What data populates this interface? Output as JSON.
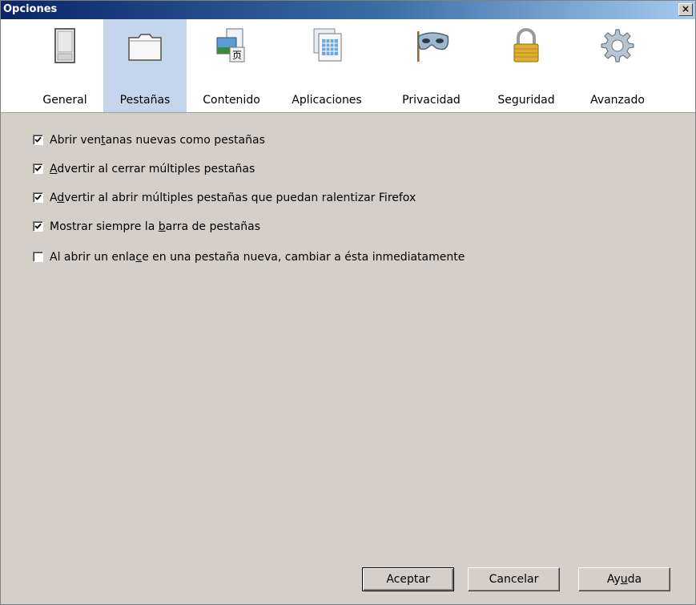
{
  "window": {
    "title": "Opciones",
    "close_label": "×"
  },
  "tabs": [
    {
      "label": "General",
      "icon": "general-icon"
    },
    {
      "label": "Pestañas",
      "icon": "tabs-icon",
      "selected": true
    },
    {
      "label": "Contenido",
      "icon": "content-icon"
    },
    {
      "label": "Aplicaciones",
      "icon": "applications-icon"
    },
    {
      "label": "Privacidad",
      "icon": "privacy-mask-icon"
    },
    {
      "label": "Seguridad",
      "icon": "padlock-icon"
    },
    {
      "label": "Avanzado",
      "icon": "gear-icon"
    }
  ],
  "options": [
    {
      "pre": "Abrir ven",
      "acc": "t",
      "post": "anas nuevas como pestañas",
      "checked": true
    },
    {
      "pre": "",
      "acc": "A",
      "post": "dvertir al cerrar múltiples pestañas",
      "checked": true
    },
    {
      "pre": "A",
      "acc": "d",
      "post": "vertir al abrir múltiples pestañas que puedan ralentizar Firefox",
      "checked": true
    },
    {
      "pre": "Mostrar siempre la ",
      "acc": "b",
      "post": "arra de pestañas",
      "checked": true
    },
    {
      "pre": "Al abrir un enla",
      "acc": "c",
      "post": "e en una pestaña nueva, cambiar a ésta inmediatamente",
      "checked": false
    }
  ],
  "buttons": {
    "ok": {
      "pre": "A",
      "acc": "",
      "post": "ceptar",
      "label": "Aceptar"
    },
    "cancel": {
      "label": "Cancelar"
    },
    "help": {
      "pre": "Ay",
      "acc": "u",
      "post": "da"
    }
  },
  "colors": {
    "selected_tab": "#c4d6ec",
    "dialog_bg": "#d4d0c8",
    "titlebar": "#0a246a"
  }
}
